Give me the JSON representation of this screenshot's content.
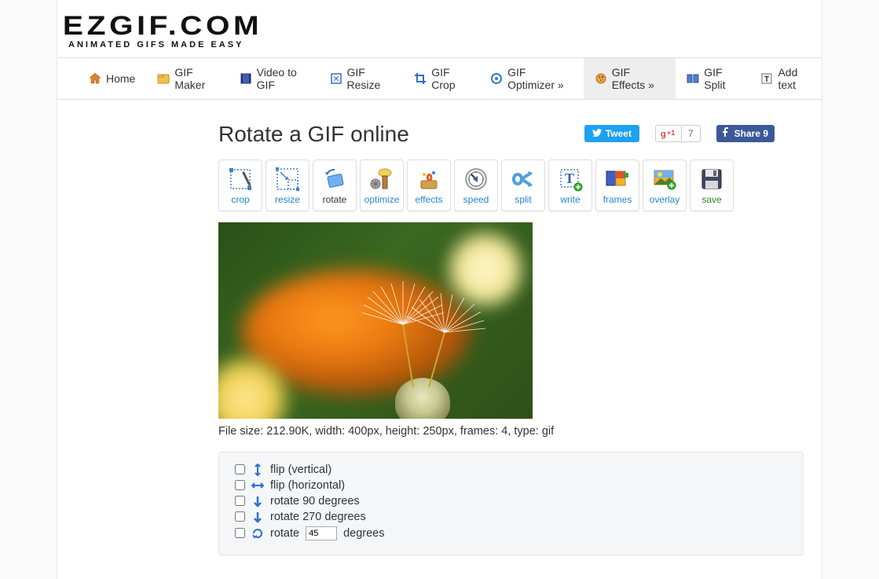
{
  "logo": {
    "main": "EZGIF.COM",
    "sub": "ANIMATED GIFS MADE EASY"
  },
  "nav": {
    "home": "Home",
    "maker": "GIF Maker",
    "video": "Video to GIF",
    "resize": "GIF Resize",
    "crop": "GIF Crop",
    "optimizer": "GIF Optimizer »",
    "effects": "GIF Effects »",
    "split": "GIF Split",
    "add_text": "Add text"
  },
  "social": {
    "tweet": "Tweet",
    "gplus_count": "7",
    "fb_share": "Share 9"
  },
  "title": "Rotate a GIF online",
  "toolbar": {
    "crop": "crop",
    "resize": "resize",
    "rotate": "rotate",
    "optimize": "optimize",
    "effects": "effects",
    "speed": "speed",
    "split": "split",
    "write": "write",
    "frames": "frames",
    "overlay": "overlay",
    "save": "save"
  },
  "file_info": "File size: 212.90K, width: 400px, height: 250px, frames: 4, type: gif",
  "options": {
    "flip_v": "flip (vertical)",
    "flip_h": "flip (horizontal)",
    "rot90": "rotate 90 degrees",
    "rot270": "rotate 270 degrees",
    "rot_custom_prefix": "rotate",
    "rot_custom_value": "45",
    "rot_custom_suffix": "degrees"
  }
}
